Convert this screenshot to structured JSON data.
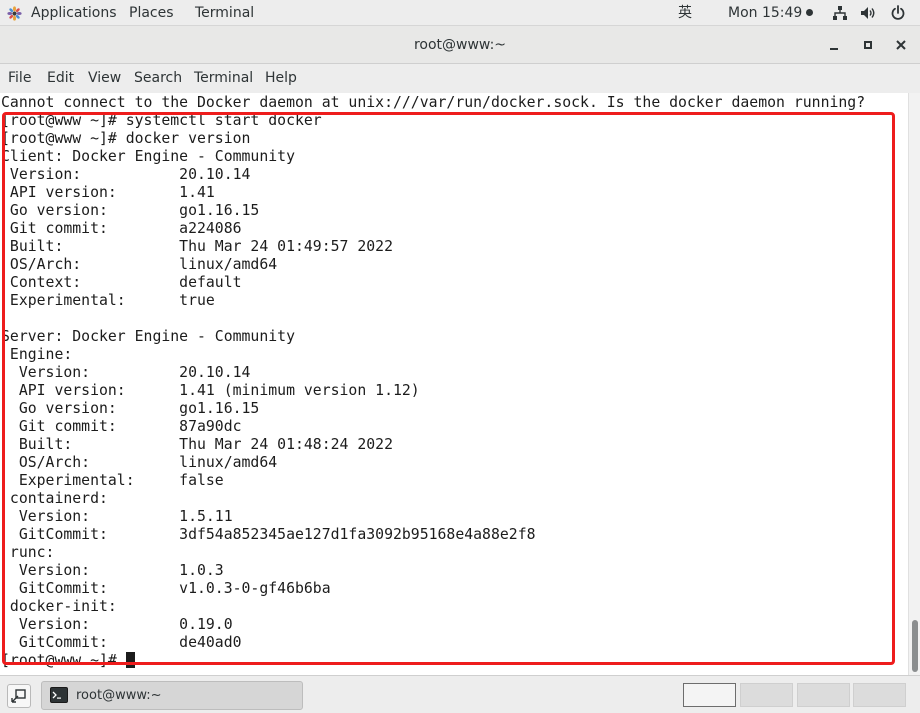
{
  "top_panel": {
    "applications": "Applications",
    "places": "Places",
    "terminal": "Terminal",
    "input_method": "英",
    "clock": "Mon 15:49",
    "icons": [
      "applications-icon",
      "network-icon",
      "volume-icon",
      "power-icon"
    ]
  },
  "window": {
    "title": "root@www:~",
    "buttons": [
      "minimize-icon",
      "maximize-icon",
      "close-icon"
    ]
  },
  "menu": [
    "File",
    "Edit",
    "View",
    "Search",
    "Terminal",
    "Help"
  ],
  "terminal": {
    "lines": [
      "Cannot connect to the Docker daemon at unix:///var/run/docker.sock. Is the docker daemon running?",
      "[root@www ~]# systemctl start docker",
      "[root@www ~]# docker version",
      "Client: Docker Engine - Community",
      " Version:           20.10.14",
      " API version:       1.41",
      " Go version:        go1.16.15",
      " Git commit:        a224086",
      " Built:             Thu Mar 24 01:49:57 2022",
      " OS/Arch:           linux/amd64",
      " Context:           default",
      " Experimental:      true",
      "",
      "Server: Docker Engine - Community",
      " Engine:",
      "  Version:          20.10.14",
      "  API version:      1.41 (minimum version 1.12)",
      "  Go version:       go1.16.15",
      "  Git commit:       87a90dc",
      "  Built:            Thu Mar 24 01:48:24 2022",
      "  OS/Arch:          linux/amd64",
      "  Experimental:     false",
      " containerd:",
      "  Version:          1.5.11",
      "  GitCommit:        3df54a852345ae127d1fa3092b95168e4a88e2f8",
      " runc:",
      "  Version:          1.0.3",
      "  GitCommit:        v1.0.3-0-gf46b6ba",
      " docker-init:",
      "  Version:          0.19.0",
      "  GitCommit:        de40ad0",
      "[root@www ~]# "
    ],
    "highlight_color": "#ee1c1c"
  },
  "taskbar": {
    "task_label": "root@www:~",
    "workspace_count": 4,
    "active_workspace": 1
  }
}
